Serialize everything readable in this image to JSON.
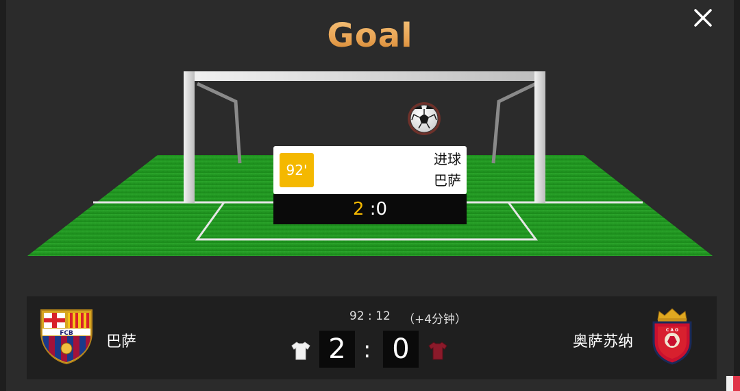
{
  "title": "Goal",
  "event": {
    "minute": "92'",
    "type": "进球",
    "team": "巴萨",
    "score_home": "2",
    "score_sep": ":",
    "score_away": "0"
  },
  "match": {
    "time": "92 : 12",
    "added_time": "（+4分钟）",
    "home_team": "巴萨",
    "away_team": "奥萨苏纳",
    "home_score": "2",
    "away_score": "0",
    "separator": ":"
  },
  "colors": {
    "accent_gold": "#f4b800",
    "pitch_green": "#1f9a1f",
    "home_jersey": "#f2f2f2",
    "away_jersey": "#8b1a2a"
  },
  "icons": {
    "close": "close-icon",
    "ball": "soccer-ball-icon",
    "home_crest": "fc-barcelona-crest-icon",
    "away_crest": "osasuna-crest-icon",
    "home_jersey": "home-jersey-icon",
    "away_jersey": "away-jersey-icon"
  },
  "crest_text": {
    "home": "FCB"
  }
}
